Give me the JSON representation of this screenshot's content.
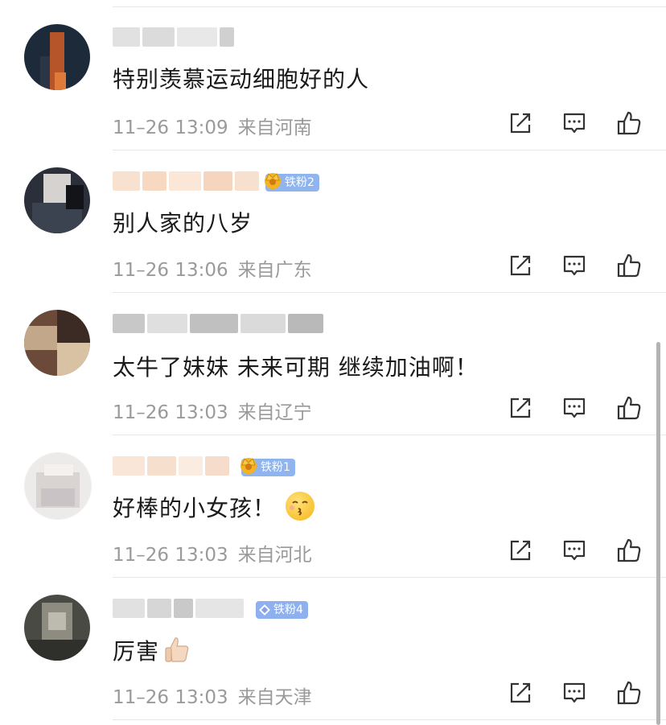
{
  "comments": [
    {
      "text": "特别羡慕运动细胞好的人",
      "time": "11–26 13:09",
      "location": "来自河南",
      "badge": null,
      "name_colors": [
        "#c9c9c9",
        "#bdbdbd",
        "#d6d6d6",
        "#a9a9a9"
      ],
      "avatar_colors": [
        "#1d2a3a",
        "#b6542a",
        "#2a3545",
        "#e07a3a"
      ]
    },
    {
      "text": "别人家的八岁",
      "time": "11–26 13:06",
      "location": "来自广东",
      "badge": "铁粉2",
      "name_colors": [
        "#f3c9a6",
        "#f0b98e",
        "#f6d3b8",
        "#efb38a",
        "#f2c7a5"
      ],
      "avatar_colors": [
        "#2b2f3a",
        "#d6d2cf",
        "#3b4250",
        "#121418"
      ]
    },
    {
      "text": "太牛了妹妹 未来可期 继续加油啊！",
      "time": "11–26 13:03",
      "location": "来自辽宁",
      "badge": null,
      "name_colors": [
        "#9a9a9a",
        "#c4c4c4",
        "#8c8c8c",
        "#bcbcbc",
        "#7f7f7f"
      ],
      "avatar_colors": [
        "#6b4a3a",
        "#c2a78a",
        "#3b2b24",
        "#d8c2a3"
      ]
    },
    {
      "text": "好棒的小女孩！",
      "time": "11–26 13:03",
      "location": "来自河北",
      "badge": "铁粉1",
      "name_colors": [
        "#f4d2b8",
        "#f0c4a4",
        "#f6dcc7",
        "#eebfa0"
      ],
      "avatar_colors": [
        "#ecebe9",
        "#d9d3d2",
        "#c9c3c6",
        "#f4f1ee"
      ]
    },
    {
      "text": "厉害",
      "time": "11–26 13:03",
      "location": "来自天津",
      "badge": "铁粉4",
      "name_colors": [
        "#c8c8c8",
        "#b5b5b5",
        "#9c9c9c",
        "#cfcfcf"
      ],
      "avatar_colors": [
        "#4a4a44",
        "#8e8b80",
        "#2f2f2b",
        "#bdbab0"
      ]
    }
  ],
  "icons": [
    "share-icon",
    "comment-icon",
    "like-icon"
  ]
}
